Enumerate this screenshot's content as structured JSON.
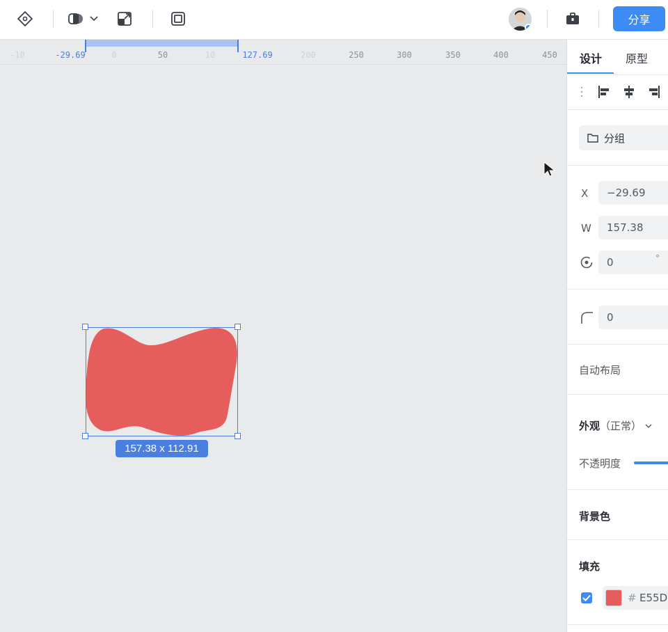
{
  "toolbar": {
    "share_label": "分享"
  },
  "ruler": {
    "ticks": [
      "-10",
      "-29.69",
      "0",
      "50",
      "10",
      "127.69",
      "200",
      "250",
      "300",
      "350",
      "400",
      "450"
    ],
    "selection_start": "-29.69",
    "selection_end": "127.69"
  },
  "canvas": {
    "size_label": "157.38 x 112.91",
    "shape_color": "#E55D5D"
  },
  "panel": {
    "tabs": [
      "设计",
      "原型"
    ],
    "group_label": "分组",
    "x_label": "X",
    "x_value": "−29.69",
    "w_label": "W",
    "w_value": "157.38",
    "rotation_value": "0",
    "rotation_unit": "°",
    "radius_value": "0",
    "auto_layout_label": "自动布局",
    "appearance_label": "外观",
    "appearance_mode": "（正常）",
    "opacity_label": "不透明度",
    "opacity": 1.0,
    "background_label": "背景色",
    "fill_label": "填充",
    "fill_hash": "#",
    "fill_hex": "E55D",
    "fill_color": "#E55D5D",
    "fill_enabled": true
  },
  "colors": {
    "accent": "#3D8BF5",
    "selection": "#4A7FE0",
    "canvas_bg": "#E9EAEB"
  }
}
